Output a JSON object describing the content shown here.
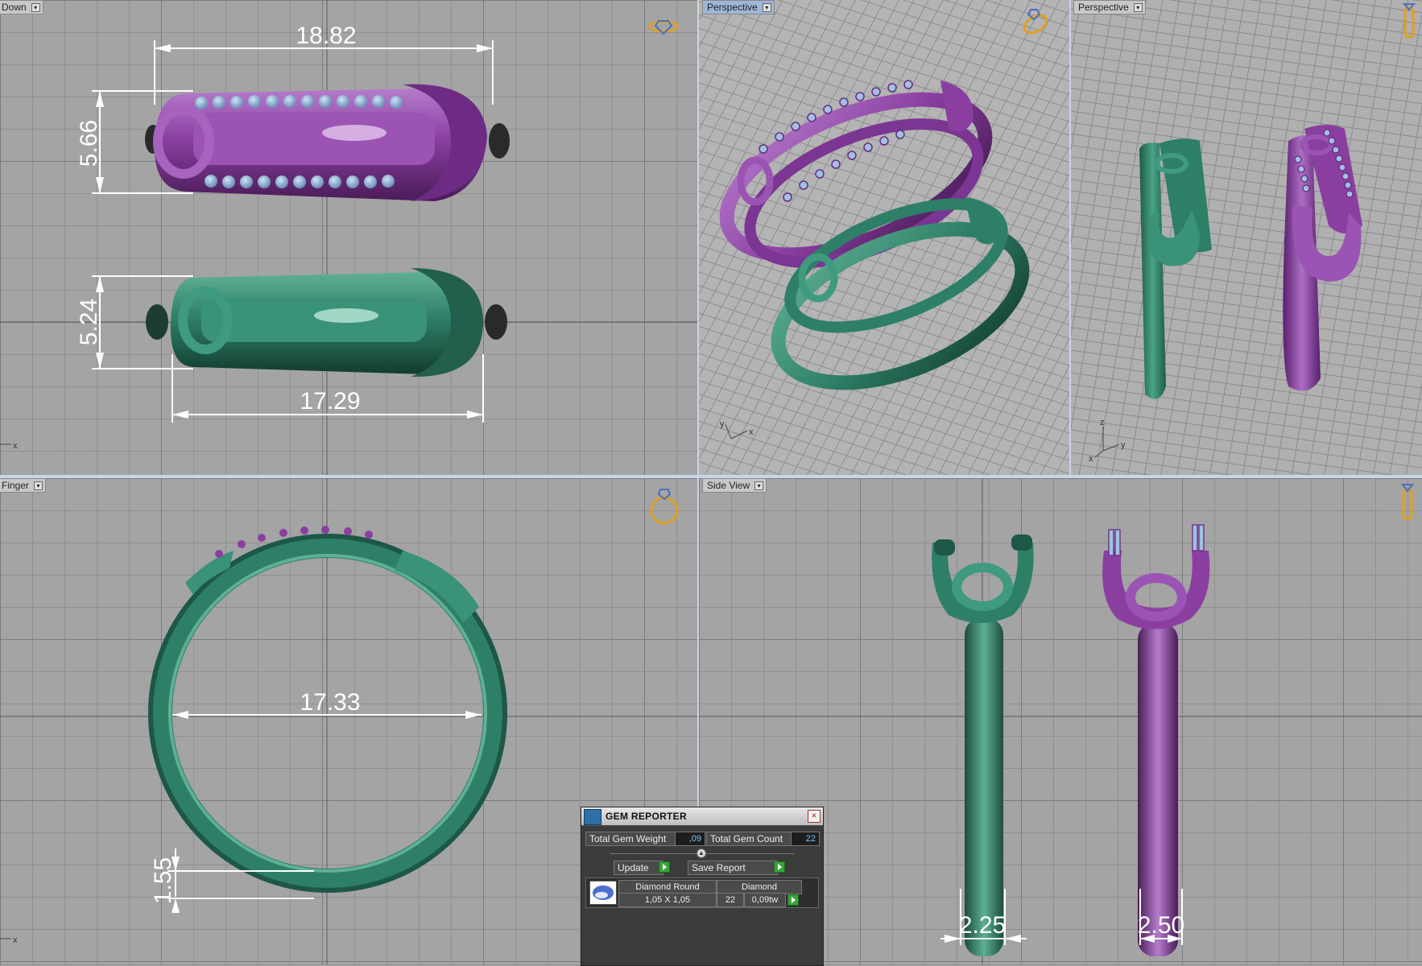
{
  "viewports": {
    "top_left": {
      "label": "Down"
    },
    "persp_1": {
      "label": "Perspective"
    },
    "persp_2": {
      "label": "Perspective"
    },
    "bottom_left": {
      "label": "Finger"
    },
    "bottom_right": {
      "label": "Side View"
    }
  },
  "dimensions": {
    "top_width": "18.82",
    "top_height": "5.66",
    "mid_height": "5.24",
    "mid_width": "17.29",
    "ring_inner": "17.33",
    "ring_thickness": "1.55",
    "side_left": "2.25",
    "side_right": "2.50"
  },
  "axes": {
    "x": "x",
    "y": "y",
    "z": "z"
  },
  "colors": {
    "purple": "#8a3fa0",
    "green": "#2e7f67",
    "gem": "#8fb4d8",
    "accent_gold": "#e0a020"
  },
  "gem_reporter": {
    "title": "GEM REPORTER",
    "weight_label": "Total Gem Weight",
    "weight_value": ",09",
    "count_label": "Total Gem Count",
    "count_value": "22",
    "update_label": "Update",
    "save_label": "Save Report",
    "table": {
      "header_shape": "Diamond Round",
      "header_material": "Diamond",
      "size": "1,05 X 1,05",
      "count": "22",
      "weight": "0,09tw"
    }
  }
}
